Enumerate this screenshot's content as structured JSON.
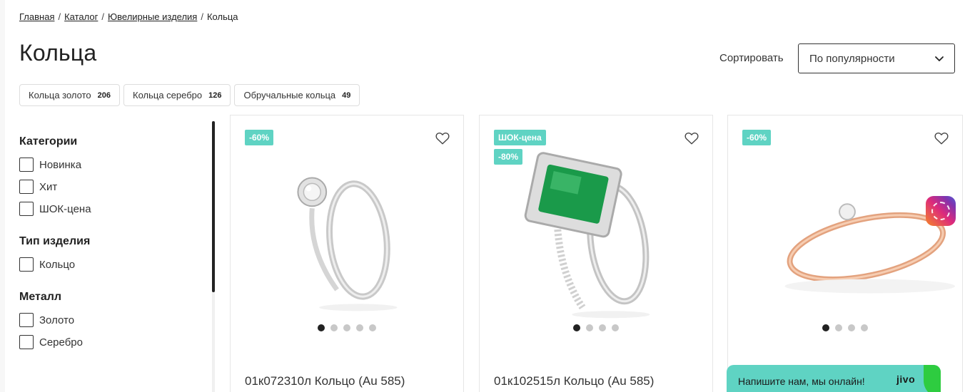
{
  "breadcrumb": {
    "items": [
      "Главная",
      "Каталог",
      "Ювелирные изделия"
    ],
    "current": "Кольца",
    "separator": "/"
  },
  "page": {
    "title": "Кольца"
  },
  "sort": {
    "label": "Сортировать",
    "value": "По популярности"
  },
  "chips": [
    {
      "label": "Кольца золото",
      "count": "206"
    },
    {
      "label": "Кольца серебро",
      "count": "126"
    },
    {
      "label": "Обручальные кольца",
      "count": "49"
    }
  ],
  "filters": {
    "categories": {
      "title": "Категории",
      "items": [
        "Новинка",
        "Хит",
        "ШОК-цена"
      ]
    },
    "type": {
      "title": "Тип изделия",
      "items": [
        "Кольцо"
      ]
    },
    "metal": {
      "title": "Металл",
      "items": [
        "Золото",
        "Серебро"
      ]
    }
  },
  "products": [
    {
      "badges": [
        "-60%"
      ],
      "title": "01к072310л Кольцо (Au 585)",
      "images_total": 5,
      "image_active": 1
    },
    {
      "badges": [
        "ШОК-цена",
        "-80%"
      ],
      "title": "01к102515л Кольцо (Au 585)",
      "images_total": 4,
      "image_active": 1
    },
    {
      "badges": [
        "-60%"
      ],
      "title": "",
      "images_total": 4,
      "image_active": 1
    }
  ],
  "chat": {
    "text": "Напишите нам, мы онлайн!",
    "brand": "jivo"
  },
  "colors": {
    "badge": "#5fd3c3",
    "chat": "#5fd3c3",
    "emerald": "#1a9a4a"
  },
  "icons": {
    "heart": "heart-icon",
    "chevron": "chevron-down-icon",
    "social": "instagram-icon"
  }
}
